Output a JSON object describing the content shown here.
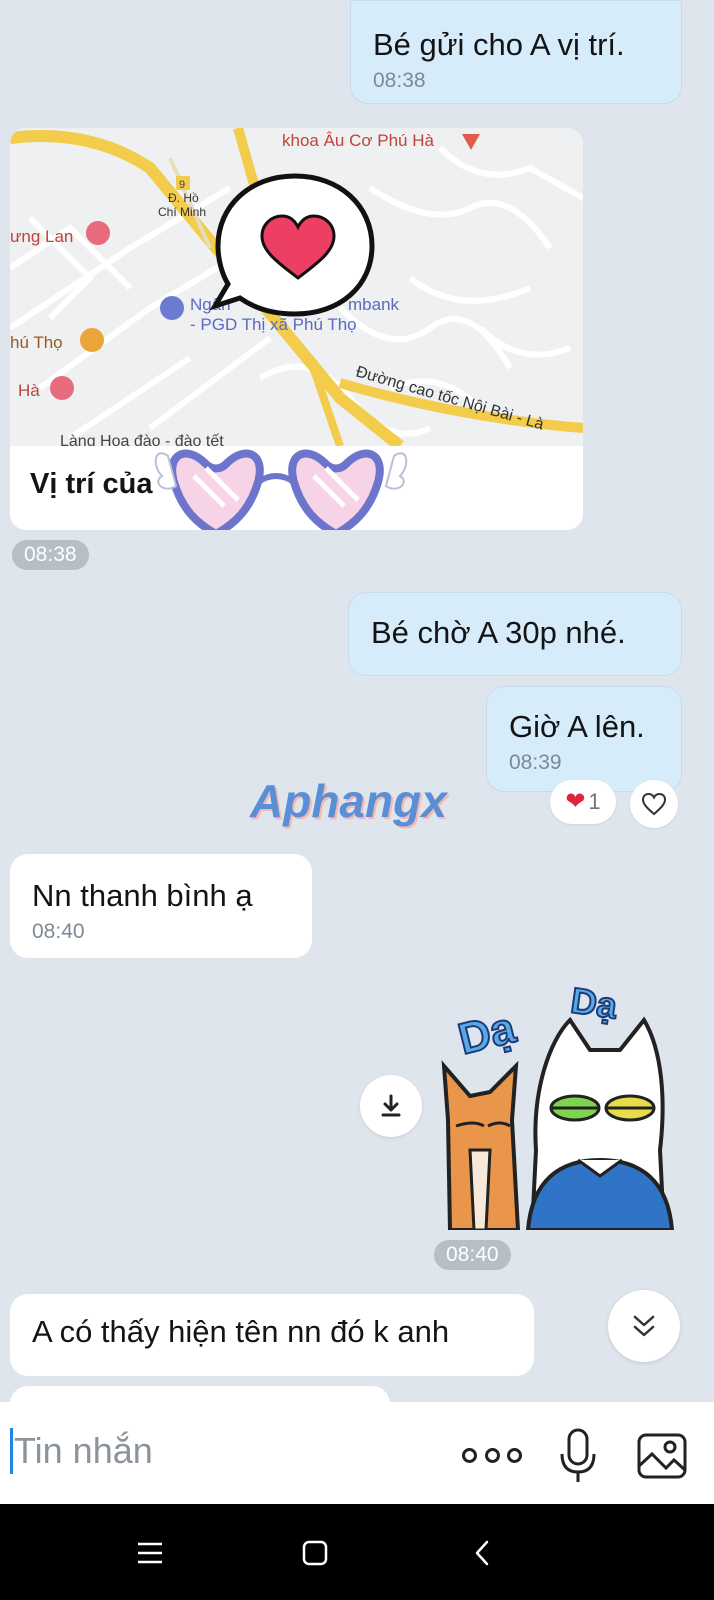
{
  "messages": {
    "m1": {
      "text": "Bé gửi cho A vị trí.",
      "time": "08:38"
    },
    "location": {
      "title_visible": "Vị trí của",
      "time": "08:38",
      "map_labels": {
        "poi_top": "khoa Âu Cơ Phú Hà",
        "road_num": "9",
        "road_name_1": "Đ. Hồ",
        "road_name_2": "Chí Minh",
        "hotel_left": "ưng Lan",
        "bar_left": "hú Thọ",
        "hotel_left2": "Hà",
        "bank_1": "Ngân",
        "bank_1b": "mbank",
        "bank_2": "- PGD Thị xã Phú Thọ",
        "highway": "Đường cao tốc Nội Bài - Là",
        "bottom": "Làng Hoa đào - đào tết"
      }
    },
    "m2": {
      "text": "Bé chờ A 30p nhé."
    },
    "m3": {
      "text": "Giờ A lên.",
      "time": "08:39",
      "reaction_count": "1"
    },
    "m4": {
      "text": "Nn thanh bình ạ",
      "time": "08:40"
    },
    "sticker": {
      "time": "08:40",
      "word_1": "Dạ",
      "word_2": "Dạ"
    },
    "m5": {
      "text": "A có thấy hiện tên nn đó k anh"
    }
  },
  "watermark": "Aphangx",
  "input": {
    "placeholder": "Tin nhắn"
  },
  "icons": {
    "heart_reaction": "red-heart",
    "like_button": "heart-outline",
    "download": "download-arrow",
    "scroll_down": "double-chevron-down",
    "more": "three-dots",
    "mic": "microphone",
    "gallery": "image"
  },
  "colors": {
    "outgoing_bubble": "#d6ecfa",
    "incoming_bubble": "#ffffff",
    "background": "#dfe5ec"
  }
}
